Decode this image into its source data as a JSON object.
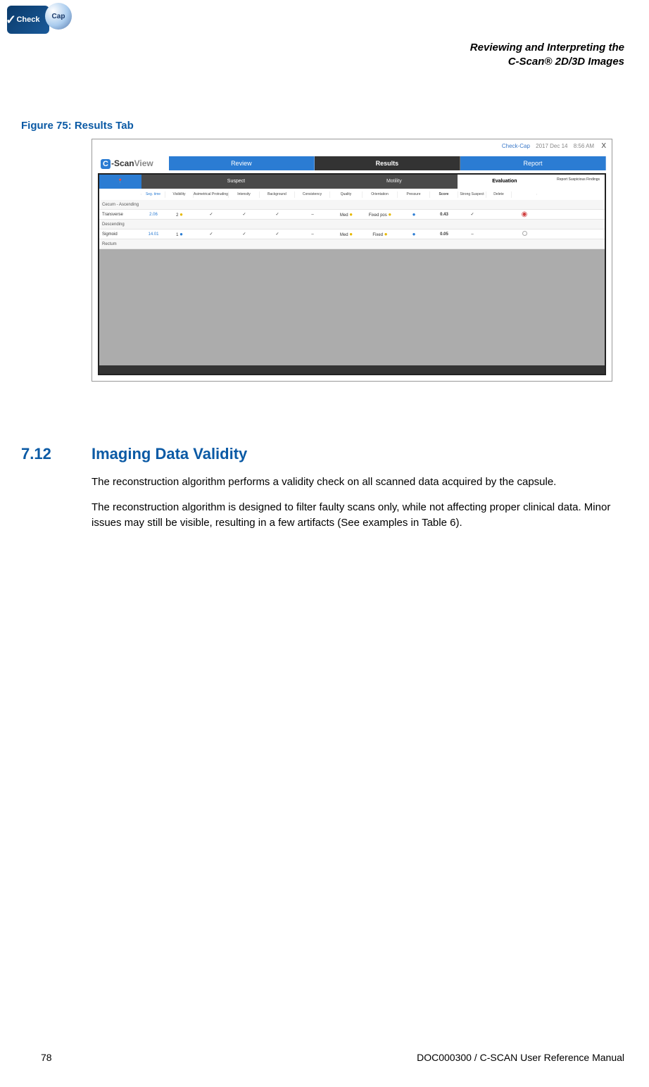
{
  "logo": {
    "check": "Check",
    "cap": "Cap"
  },
  "header": {
    "line1": "Reviewing and Interpreting the",
    "line2": "C-Scan® 2D/3D Images"
  },
  "figure_caption": "Figure 75: Results Tab",
  "screenshot": {
    "brand": "Check-Cap",
    "date": "2017 Dec 14",
    "time": "8:56 AM",
    "close": "X",
    "app_logo": {
      "c": "C",
      "scan": "-Scan",
      "view": "View"
    },
    "tabs": {
      "review": "Review",
      "results": "Results",
      "report": "Report"
    },
    "groups": {
      "locator": "Seg. time",
      "suspect": "Suspect",
      "motility": "Motility",
      "evaluation": "Evaluation",
      "report": "Report Suspicious Findings"
    },
    "columns": {
      "seg": "Seg. time",
      "visibility": "Visibility",
      "asym": "Asimetrical Protruding",
      "intensity": "Intensity",
      "background": "Background",
      "consistency": "Consistency",
      "quality": "Quality",
      "orientation": "Orientation",
      "pressure": "Pressure",
      "score": "Score",
      "strong": "Strong Suspect",
      "delete": "Delete",
      "rsf": ""
    },
    "rows": [
      {
        "type": "header",
        "label": "Cecum - Ascending"
      },
      {
        "type": "data",
        "label": "Transverse",
        "seg": "2.06",
        "vis": "2",
        "vis_dot": "y",
        "asym": "✓",
        "int": "✓",
        "bg": "✓",
        "cons": "–",
        "qual": "Med",
        "qual_dot": "y",
        "orient": "Fixed pos",
        "orient_dot": "y",
        "press": "b",
        "score": "0.43",
        "ss": "✓",
        "rsf": "filled"
      },
      {
        "type": "header",
        "label": "Descending"
      },
      {
        "type": "data",
        "label": "Sigmoid",
        "seg": "14.01",
        "vis": "1",
        "vis_dot": "b",
        "asym": "✓",
        "int": "✓",
        "bg": "✓",
        "cons": "–",
        "qual": "Med",
        "qual_dot": "y",
        "orient": "Fixed",
        "orient_dot": "y",
        "press": "b",
        "score": "0.05",
        "ss": "–",
        "rsf": "empty"
      },
      {
        "type": "header",
        "label": "Rectum"
      }
    ]
  },
  "section": {
    "number": "7.12",
    "title": "Imaging Data Validity",
    "p1": "The reconstruction algorithm performs a validity check on all scanned data acquired by the capsule.",
    "p2": "The reconstruction algorithm is designed to filter faulty scans only, while not affecting proper clinical data. Minor issues may still be visible, resulting in a few artifacts (See examples in Table 6)."
  },
  "footer": {
    "page": "78",
    "doc": "DOC000300 / C-SCAN User Reference Manual"
  }
}
